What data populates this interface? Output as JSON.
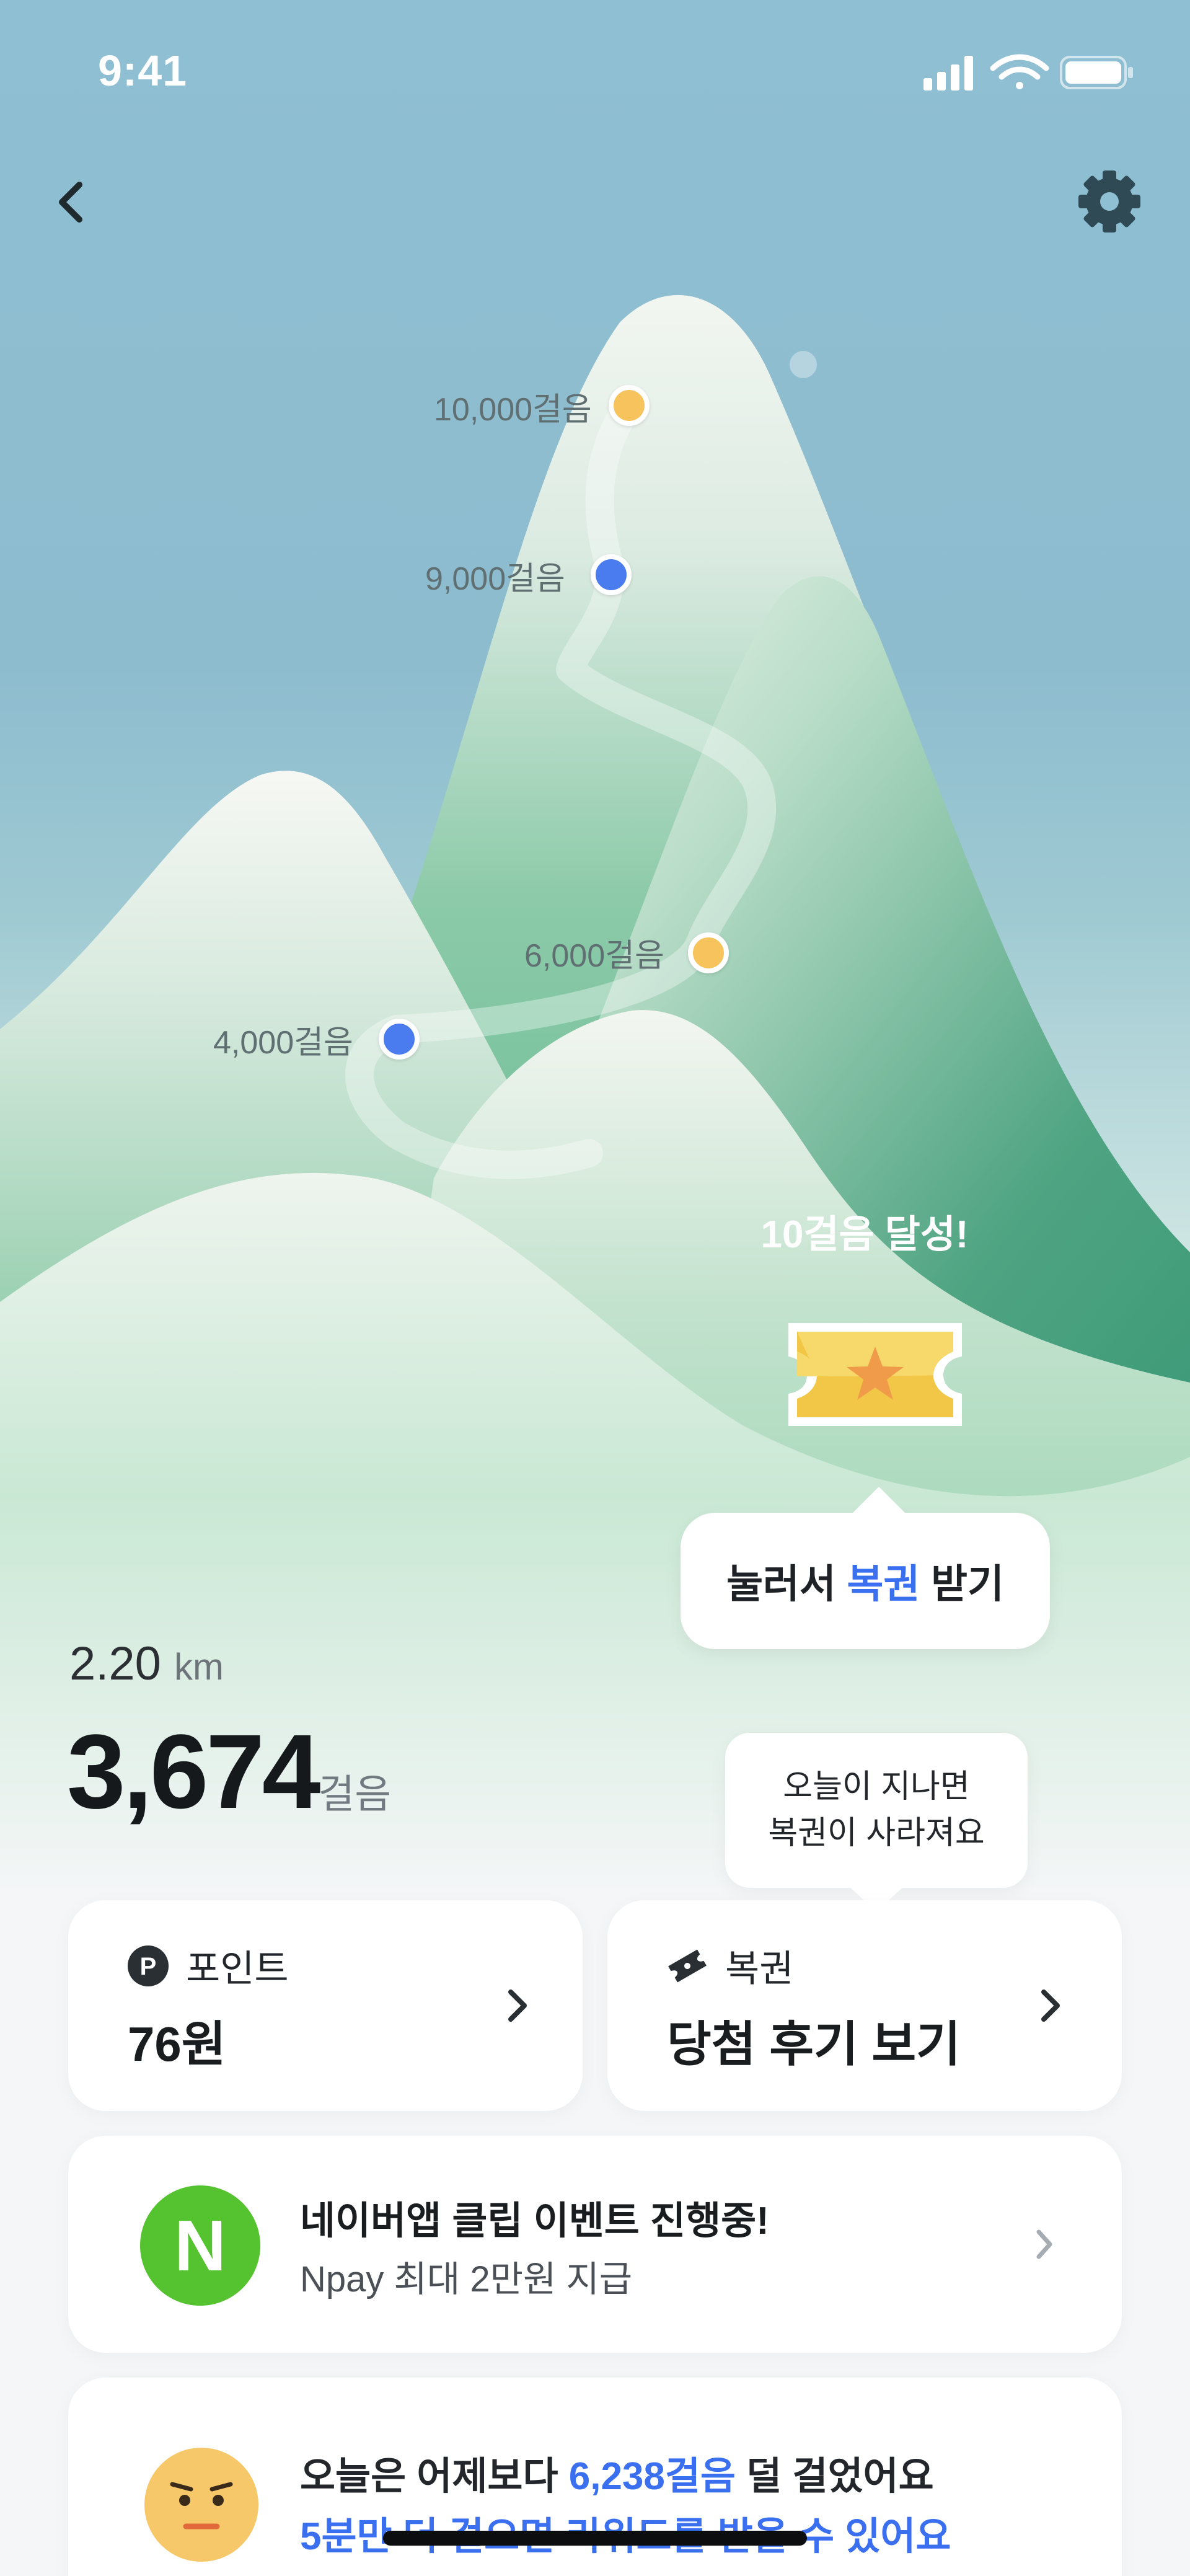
{
  "status_bar": {
    "time": "9:41"
  },
  "nav": {
    "back_icon": "chevron-left-icon",
    "settings_icon": "gear-icon"
  },
  "milestones": [
    {
      "label": "10,000걸음",
      "color": "yellow"
    },
    {
      "label": "9,000걸음",
      "color": "blue"
    },
    {
      "label": "6,000걸음",
      "color": "yellow"
    },
    {
      "label": "4,000걸음",
      "color": "blue"
    }
  ],
  "achievement": {
    "text": "10걸음 달성!",
    "ticket_icon": "lottery-ticket-icon",
    "claim_prefix": "눌러서 ",
    "claim_highlight": "복권",
    "claim_suffix": " 받기"
  },
  "stats": {
    "distance_value": "2.20",
    "distance_unit": "km",
    "steps_value": "3,674",
    "steps_unit": "걸음"
  },
  "warning_bubble": {
    "line1": "오늘이 지나면",
    "line2": "복권이 사라져요"
  },
  "cards": {
    "points": {
      "icon": "point-icon",
      "label": "포인트",
      "value": "76원"
    },
    "lotto": {
      "icon": "ticket-icon",
      "label": "복권",
      "value": "당첨 후기 보기"
    }
  },
  "event": {
    "logo_letter": "N",
    "title": "네이버앱 클립 이벤트 진행중!",
    "subtitle": "Npay 최대 2만원 지급"
  },
  "comparison": {
    "line1_prefix": "오늘은 어제보다 ",
    "line1_highlight": "6,238걸음",
    "line1_suffix": " 덜 걸었어요",
    "line2": "5분만 더 걸으면 리워드를 받을 수 있어요"
  },
  "colors": {
    "accent_blue": "#3a6ff0",
    "milestone_yellow": "#f6c35c",
    "milestone_blue": "#4a7cf0",
    "naver_green": "#55c22f",
    "sky": "#8fbfd2"
  }
}
